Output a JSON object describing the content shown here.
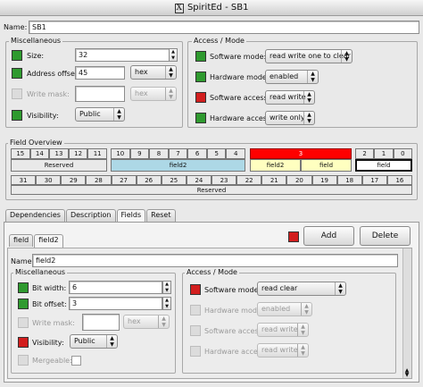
{
  "window": {
    "title": "SpiritEd - SB1",
    "x_badge": "X"
  },
  "name_row": {
    "label": "Name:",
    "value": "SB1"
  },
  "misc": {
    "title": "Miscellaneous",
    "size_label": "Size:",
    "size_value": "32",
    "offset_label": "Address offset:",
    "offset_value": "45",
    "offset_format": "hex",
    "writemask_label": "Write mask:",
    "writemask_value": "",
    "writemask_format": "hex",
    "visibility_label": "Visibility:",
    "visibility_value": "Public"
  },
  "access": {
    "title": "Access / Mode",
    "sw_mode_label": "Software mode:",
    "sw_mode_value": "read write one to clear",
    "hw_mode_label": "Hardware mode:",
    "hw_mode_value": "enabled",
    "sw_access_label": "Software access:",
    "sw_access_value": "read write",
    "hw_access_label": "Hardware access:",
    "hw_access_value": "write only"
  },
  "field_overview": {
    "title": "Field Overview",
    "top_bits": [
      {
        "cells": [
          "15",
          "14",
          "13",
          "12",
          "11"
        ],
        "name": "Reserved",
        "color": "#e9e9e9"
      },
      {
        "cells": [
          "10",
          "9",
          "8",
          "7",
          "6",
          "5",
          "4"
        ],
        "name": "field2",
        "color": "#add8e6"
      },
      {
        "cells": [
          "3"
        ],
        "name": "field2 | field",
        "color": "#ffffc0"
      },
      {
        "cells": [
          "2",
          "1",
          "0"
        ],
        "name": "field",
        "color": "#ffffff"
      }
    ],
    "sub_field_a": "field2",
    "sub_field_b": "field",
    "bottom_bits": [
      "31",
      "30",
      "29",
      "28",
      "27",
      "26",
      "25",
      "24",
      "23",
      "22",
      "21",
      "20",
      "19",
      "18",
      "17",
      "16"
    ],
    "bottom_name": "Reserved"
  },
  "tabs": [
    "Dependencies",
    "Description",
    "Fields",
    "Reset"
  ],
  "fields_panel": {
    "subtabs": [
      "field",
      "field2"
    ],
    "add_label": "Add",
    "delete_label": "Delete",
    "name_label": "Name:",
    "name_value": "field2",
    "misc": {
      "title": "Miscellaneous",
      "bitwidth_label": "Bit width:",
      "bitwidth_value": "6",
      "bitoffset_label": "Bit offset:",
      "bitoffset_value": "3",
      "writemask_label": "Write mask:",
      "writemask_value": "",
      "writemask_format": "hex",
      "visibility_label": "Visibility:",
      "visibility_value": "Public",
      "mergeable_label": "Mergeable:"
    },
    "access": {
      "title": "Access / Mode",
      "sw_mode_label": "Software mode:",
      "sw_mode_value": "read clear",
      "hw_mode_label": "Hardware mode:",
      "hw_mode_value": "enabled",
      "sw_access_label": "Software access:",
      "sw_access_value": "read write",
      "hw_access_label": "Hardware access:",
      "hw_access_value": "read write"
    }
  },
  "colors": {
    "green": "#2f9a2f",
    "red": "#d21e1e",
    "field2_blue": "#add8e6",
    "yellow": "#ffffc0",
    "highlight_red": "#ff0000"
  }
}
